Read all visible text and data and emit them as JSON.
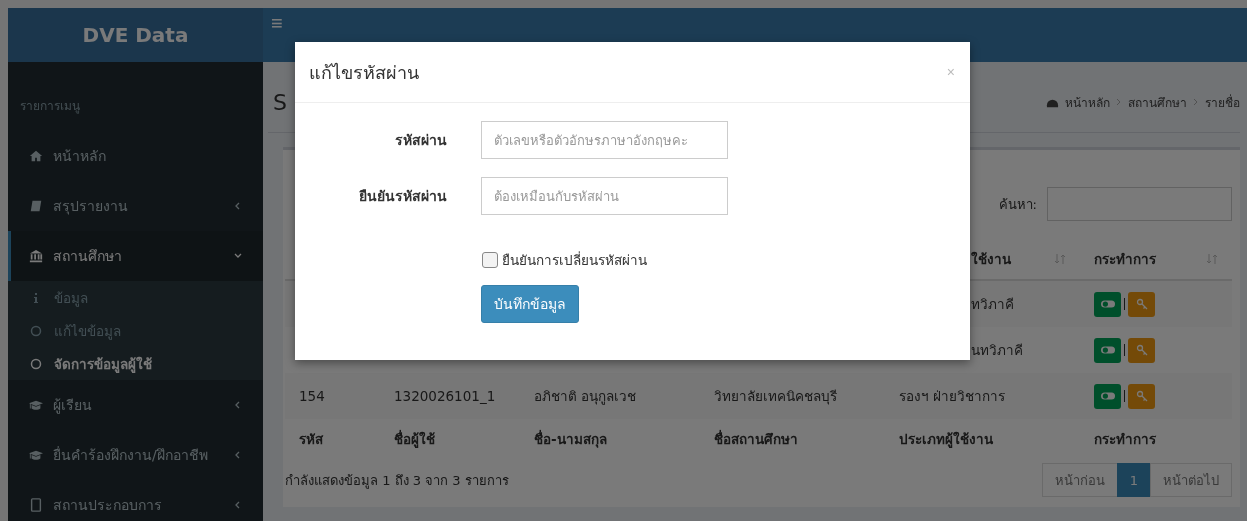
{
  "header": {
    "logo": "DVE Data",
    "menu_toggle": "≡"
  },
  "sidebar": {
    "heading": "รายการเมนู",
    "items": [
      {
        "label": "หน้าหลัก"
      },
      {
        "label": "สรุปรายงาน",
        "expanded": false
      },
      {
        "label": "สถานศึกษา",
        "expanded": true,
        "children": [
          {
            "label": "ข้อมูล",
            "selected": false
          },
          {
            "label": "แก้ไขข้อมูล",
            "selected": false
          },
          {
            "label": "จัดการข้อมูลผู้ใช้",
            "selected": true
          }
        ]
      },
      {
        "label": "ผู้เรียน",
        "expanded": false
      },
      {
        "label": "ยื่นคำร้องฝึกงาน/ฝึกอาชีพ",
        "expanded": false
      },
      {
        "label": "สถานประกอบการ",
        "expanded": false
      }
    ]
  },
  "content": {
    "title": "S",
    "breadcrumb": [
      "หน้าหลัก",
      "สถานศึกษา",
      "รายชื่อ"
    ],
    "search": {
      "label": "ค้นหา:"
    },
    "table": {
      "header": [
        "ใช้งาน",
        "กระทำการ"
      ],
      "rows": [
        {
          "cells": [
            "ทวิภาคี"
          ]
        },
        {
          "cells": [
            "นทวิภาคี"
          ]
        },
        {
          "cells": [
            "154",
            "1320026101_1",
            "อภิชาติ อนุกูลเวช",
            "วิทยาลัยเทคนิคชลบุรี",
            "รองฯ ฝ่ายวิชาการ"
          ]
        }
      ],
      "footer": [
        "รหัส",
        "ชื่อผู้ใช้",
        "ชื่อ-นามสกุล",
        "ชื่อสถานศึกษา",
        "ประเภทผู้ใช้งาน",
        "กระทำการ"
      ]
    },
    "info": "กำลังแสดงข้อมูล 1 ถึง 3 จาก 3 รายการ",
    "pagination": [
      {
        "label": "หน้าก่อน",
        "selected": false
      },
      {
        "label": "1",
        "selected": true
      },
      {
        "label": "หน้าต่อไป",
        "selected": false
      }
    ]
  },
  "modal": {
    "title": "แก้ไขรหัสผ่าน",
    "close": "×",
    "fields": [
      {
        "label": "รหัสผ่าน",
        "placeholder": "ตัวเลขหรือตัวอักษรภาษาอังกฤษคะ"
      },
      {
        "label": "ยืนยันรหัสผ่าน",
        "placeholder": "ต้องเหมือนกับรหัสผ่าน"
      }
    ],
    "checkbox": {
      "label": "ยืนยันการเปลี่ยนรหัสผ่าน",
      "checked": false
    },
    "button": "บันทึกข้อมูล"
  }
}
